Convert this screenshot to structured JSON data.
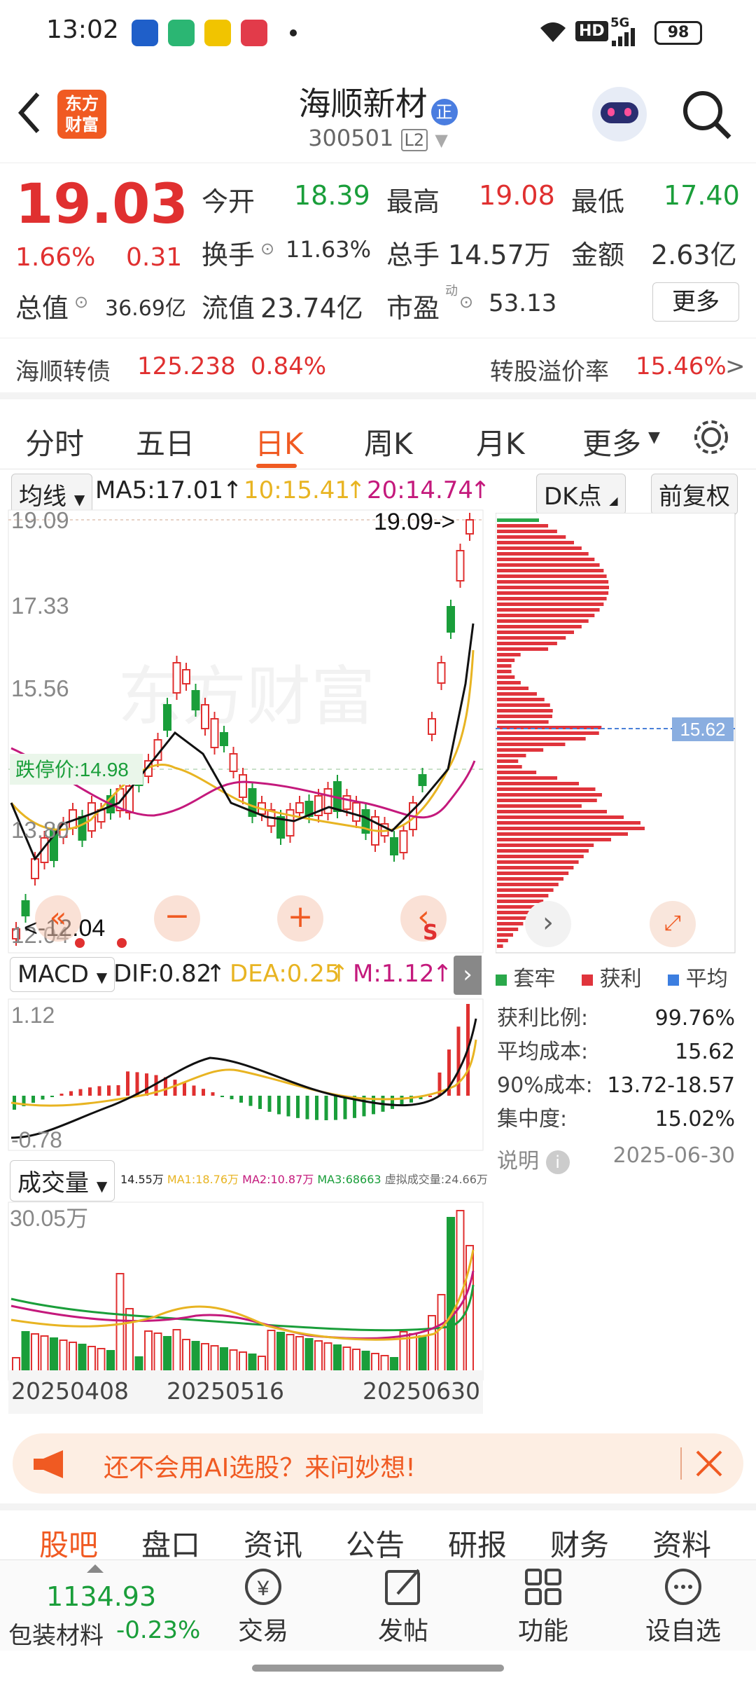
{
  "status": {
    "time": "13:02",
    "network": "5G",
    "hd": "HD",
    "battery": "98"
  },
  "header": {
    "logo_line1": "东方",
    "logo_line2": "财富",
    "stock_name": "海顺新材",
    "badge": "正",
    "stock_code": "300501",
    "level": "L2"
  },
  "quote": {
    "price": "19.03",
    "change_pct": "1.66%",
    "change": "0.31",
    "open_label": "今开",
    "open": "18.39",
    "high_label": "最高",
    "high": "19.08",
    "low_label": "最低",
    "low": "17.40",
    "turnover_label": "换手",
    "turnover": "11.63%",
    "volume_label": "总手",
    "volume": "14.57万",
    "amount_label": "金额",
    "amount": "2.63亿",
    "mcap_label": "总值",
    "mcap": "36.69亿",
    "float_label": "流值",
    "float": "23.74亿",
    "pe_label": "市盈",
    "pe_sup": "动",
    "pe": "53.13",
    "more": "更多"
  },
  "bond": {
    "name": "海顺转债",
    "price": "125.238",
    "pct": "0.84%",
    "premium_label": "转股溢价率",
    "premium": "15.46%",
    "arrow": ">"
  },
  "tabs": [
    {
      "label": "分时"
    },
    {
      "label": "五日"
    },
    {
      "label": "日K"
    },
    {
      "label": "周K"
    },
    {
      "label": "月K"
    },
    {
      "label": "更多"
    }
  ],
  "kline": {
    "ma_select": "均线",
    "ma5": "MA5:17.01",
    "ma10": "10:15.41",
    "ma20": "20:14.74",
    "dk": "DK点",
    "adjust": "前复权",
    "y_labels": [
      "19.09",
      "17.33",
      "15.56",
      "13.80",
      "12.04"
    ],
    "high_mark": "19.09->",
    "low_mark": "<-12.04",
    "limit_down": "跌停价:14.98",
    "chip_avg": "15.62",
    "watermark": "东方财富",
    "s_mark": "S"
  },
  "macd": {
    "select": "MACD",
    "dif": "DIF:0.82",
    "dea": "DEA:0.25",
    "m": "M:1.12",
    "top": "1.12",
    "bottom": "-0.78"
  },
  "vol": {
    "select": "成交量",
    "info1": "14.55万",
    "info2": "MA1:18.76万",
    "info3": "MA2:10.87万",
    "info4": "MA3:68663",
    "info5": "虚拟成交量:24.66万",
    "top": "30.05万"
  },
  "dates": [
    "20250408",
    "20250516",
    "20250630"
  ],
  "chips": {
    "legend": [
      "套牢",
      "获利",
      "平均"
    ],
    "rows": [
      {
        "label": "获利比例:",
        "value": "99.76%"
      },
      {
        "label": "平均成本:",
        "value": "15.62"
      },
      {
        "label": "90%成本:",
        "value": "13.72-18.57"
      },
      {
        "label": "集中度:",
        "value": "15.02%"
      }
    ],
    "note": "说明",
    "date": "2025-06-30"
  },
  "ai_banner": {
    "text": "还不会用AI选股？来问妙想!"
  },
  "subtabs": [
    "股吧",
    "盘口",
    "资讯",
    "公告",
    "研报",
    "财务",
    "资料"
  ],
  "bottom": {
    "index_value": "1134.93",
    "index_name": "包装材料",
    "index_pct": "-0.23%",
    "items": [
      {
        "label": "交易"
      },
      {
        "label": "发帖"
      },
      {
        "label": "功能"
      },
      {
        "label": "设自选"
      }
    ]
  },
  "chart_data": [
    {
      "type": "bar",
      "title": "",
      "ylim": [
        12.04,
        19.09
      ],
      "categories": [],
      "series": [
        {
          "name": "MA5",
          "values": [
            17.01
          ]
        },
        {
          "name": "10",
          "values": [
            15.41
          ]
        },
        {
          "name": "20",
          "values": [
            14.74
          ]
        }
      ]
    },
    {
      "type": "bar",
      "title": "",
      "ylim": [
        -0.78,
        1.12
      ],
      "categories": [],
      "series": [
        {
          "name": "DIF",
          "values": [
            0.82
          ]
        },
        {
          "name": "DEA",
          "values": [
            0.25
          ]
        },
        {
          "name": "M",
          "values": [
            1.12
          ]
        }
      ]
    }
  ]
}
